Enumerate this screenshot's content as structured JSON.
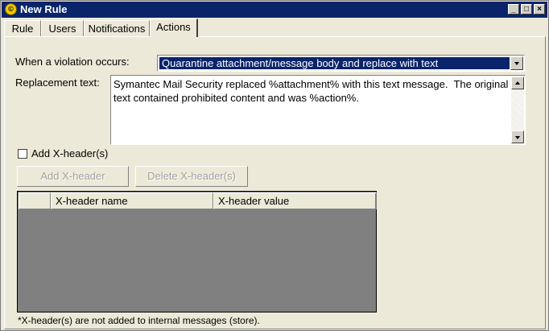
{
  "window": {
    "title": "New Rule",
    "icon_name": "symantec-app-icon",
    "controls": [
      "minimize",
      "maximize",
      "close"
    ]
  },
  "tabs": [
    {
      "label": "Rule",
      "active": false
    },
    {
      "label": "Users",
      "active": false
    },
    {
      "label": "Notifications",
      "active": false
    },
    {
      "label": "Actions",
      "active": true
    }
  ],
  "actions": {
    "violation_label": "When a violation occurs:",
    "violation_value": "Quarantine attachment/message body and replace with text",
    "replacement_label": "Replacement text:",
    "replacement_value": "Symantec Mail Security replaced %attachment% with this text message.  The original text contained prohibited content and was %action%.",
    "add_xheader_checkbox_label": "Add X-header(s)",
    "add_xheader_checked": false,
    "add_xheader_button": "Add X-header",
    "delete_xheader_button": "Delete X-header(s)",
    "xheader_columns": [
      "",
      "X-header name",
      "X-header value"
    ],
    "xheader_rows": [],
    "footnote": "*X-header(s) are not added to internal messages (store)."
  },
  "colors": {
    "titlebar": "#0a246a",
    "selection": "#0a246a",
    "dialog_bg": "#ece9d8",
    "list_bg": "#808080"
  }
}
